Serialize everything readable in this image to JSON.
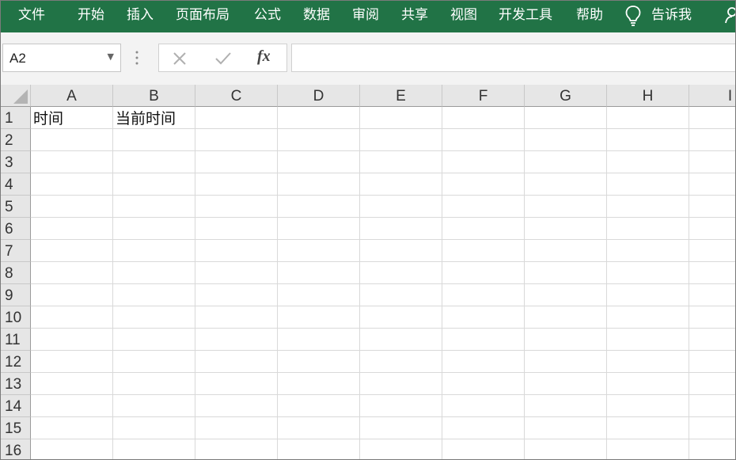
{
  "ribbon": {
    "tabs": [
      "文件",
      "开始",
      "插入",
      "页面布局",
      "公式",
      "数据",
      "审阅",
      "共享",
      "视图",
      "开发工具",
      "帮助"
    ],
    "tell_me": "告诉我",
    "color": "#217346"
  },
  "formula_bar": {
    "name_box": "A2",
    "fx_label": "fx",
    "content": ""
  },
  "sheet": {
    "columns": [
      "A",
      "B",
      "C",
      "D",
      "E",
      "F",
      "G",
      "H",
      "I"
    ],
    "rows": [
      "1",
      "2",
      "3",
      "4",
      "5",
      "6",
      "7",
      "8",
      "9",
      "10",
      "11",
      "12",
      "13",
      "14",
      "15",
      "16"
    ],
    "cells": {
      "A1": "时间",
      "B1": "当前时间"
    }
  }
}
